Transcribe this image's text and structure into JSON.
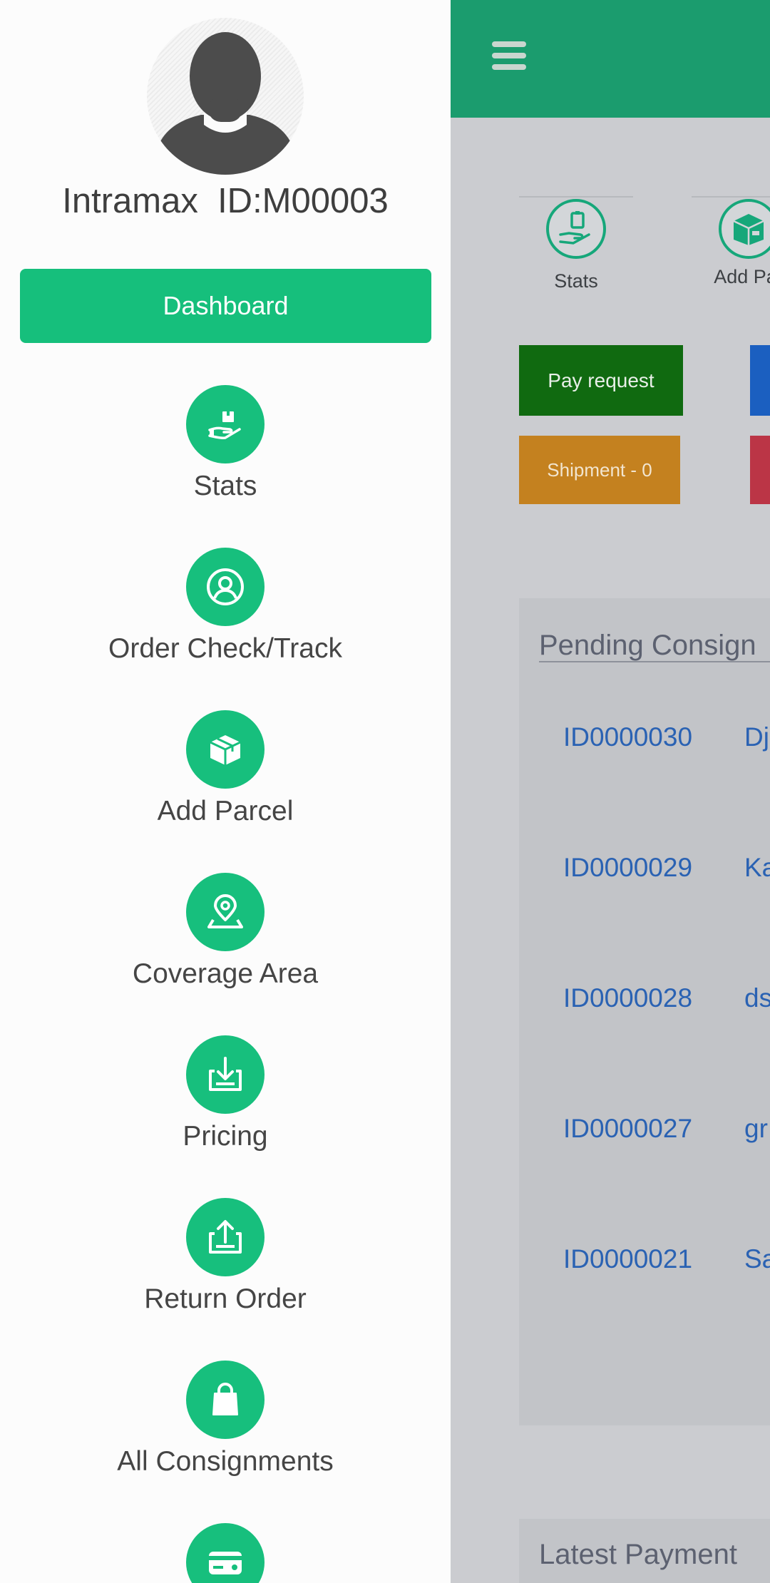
{
  "profile": {
    "name": "Intramax  ID:M00003"
  },
  "drawer": {
    "dashboard_label": "Dashboard",
    "items": [
      {
        "label": "Stats",
        "icon": "hand-parcel-icon"
      },
      {
        "label": "Order Check/Track",
        "icon": "user-circle-icon"
      },
      {
        "label": "Add Parcel",
        "icon": "box-icon"
      },
      {
        "label": "Coverage Area",
        "icon": "map-pin-icon"
      },
      {
        "label": "Pricing",
        "icon": "download-tray-icon"
      },
      {
        "label": "Return Order",
        "icon": "upload-tray-icon"
      },
      {
        "label": "All Consignments",
        "icon": "shopping-bag-icon"
      },
      {
        "label": "",
        "icon": "credit-card-icon"
      }
    ]
  },
  "quick_tiles": [
    {
      "label": "Stats",
      "icon": "hand-parcel-icon"
    },
    {
      "label": "Add Par",
      "icon": "box-icon"
    }
  ],
  "actions": {
    "pay_request": "Pay request",
    "shipment": "Shipment - 0"
  },
  "pending": {
    "title": "Pending Consign",
    "rows": [
      {
        "id": "ID0000030",
        "name": "Dj"
      },
      {
        "id": "ID0000029",
        "name": "Ka"
      },
      {
        "id": "ID0000028",
        "name": "ds"
      },
      {
        "id": "ID0000027",
        "name": "gr"
      },
      {
        "id": "ID0000021",
        "name": "Sa"
      }
    ]
  },
  "latest_payment": {
    "title": "Latest Payment"
  },
  "colors": {
    "brand_green": "#17bf7d",
    "topbar_green": "#1b9c6e",
    "pay_request": "#106a10",
    "shipment": "#c4811f",
    "link_blue": "#2a62b3"
  }
}
